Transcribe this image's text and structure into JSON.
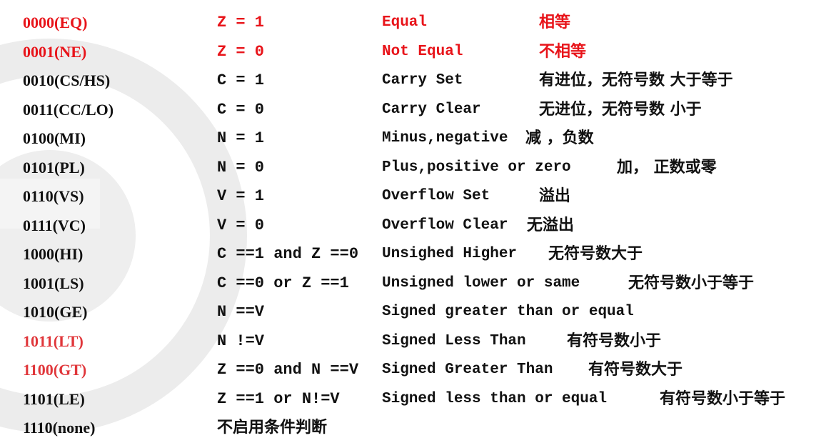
{
  "rows": [
    {
      "code": "0000(EQ)",
      "condition": "Z = 1",
      "description": "Equal",
      "chinese": "相等",
      "color": "#e8141a"
    },
    {
      "code": "0001(NE)",
      "condition": "Z = 0",
      "description": "Not Equal",
      "chinese": "不相等",
      "color": "#e8141a"
    },
    {
      "code": "0010(CS/HS)",
      "condition": "C = 1",
      "description": "Carry Set",
      "chinese": "有进位，无符号数 大于等于",
      "color": "#111111"
    },
    {
      "code": "0011(CC/LO)",
      "condition": "C = 0",
      "description": "Carry Clear",
      "chinese": "无进位，无符号数 小于",
      "color": "#111111"
    },
    {
      "code": "0100(MI)",
      "condition": "N = 1",
      "description": "Minus,negative",
      "chinese": "减 ，负数",
      "color": "#111111"
    },
    {
      "code": "0101(PL)",
      "condition": "N = 0",
      "description": "Plus,positive or zero",
      "chinese": "加， 正数或零",
      "color": "#111111"
    },
    {
      "code": "0110(VS)",
      "condition": "V = 1",
      "description": "Overflow Set",
      "chinese": "溢出",
      "color": "#111111"
    },
    {
      "code": "0111(VC)",
      "condition": "V = 0",
      "description": "Overflow Clear",
      "chinese": "无溢出",
      "color": "#111111"
    },
    {
      "code": "1000(HI)",
      "condition": "C ==1 and Z ==0",
      "description": "Unsighed Higher",
      "chinese": "无符号数大于",
      "color": "#111111"
    },
    {
      "code": "1001(LS)",
      "condition": "C ==0 or Z ==1",
      "description": "Unsigned lower or same",
      "chinese": "无符号数小于等于",
      "color": "#111111"
    },
    {
      "code": "1010(GE)",
      "condition": "N ==V",
      "description": "Signed greater than or equal",
      "chinese": "",
      "color": "#111111"
    },
    {
      "code": "1011(LT)",
      "condition": "N !=V",
      "description": "Signed Less Than",
      "chinese": "有符号数小于",
      "color": "#e0363a"
    },
    {
      "code": "1100(GT)",
      "condition": "Z ==0 and N ==V",
      "description": "Signed Greater Than",
      "chinese": "有符号数大于",
      "color": "#e0363a"
    },
    {
      "code": "1101(LE)",
      "condition": "Z ==1 or N!=V",
      "description": "Signed less than or equal",
      "chinese": "有符号数小于等于",
      "color": "#111111"
    },
    {
      "code": "1110(none)",
      "condition": "不启用条件判断",
      "description": "",
      "chinese": "",
      "color": "#111111"
    }
  ]
}
